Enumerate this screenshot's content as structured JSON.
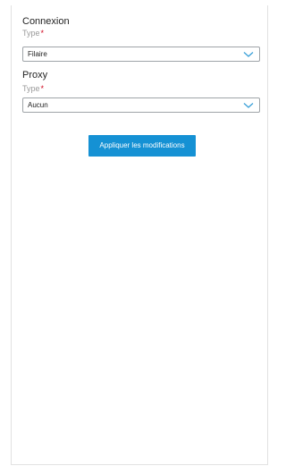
{
  "connexion": {
    "title": "Connexion",
    "type_label": "Type",
    "required_mark": "*",
    "selected": "Filaire"
  },
  "proxy": {
    "title": "Proxy",
    "type_label": "Type",
    "required_mark": "*",
    "selected": "Aucun"
  },
  "actions": {
    "apply_label": "Appliquer les modifications"
  },
  "icons": {
    "dropdown": "chevron-down-icon"
  },
  "colors": {
    "accent": "#1591d4",
    "chevron": "#3aa0d8",
    "required": "#d0021b",
    "label": "#9a9a9a"
  }
}
